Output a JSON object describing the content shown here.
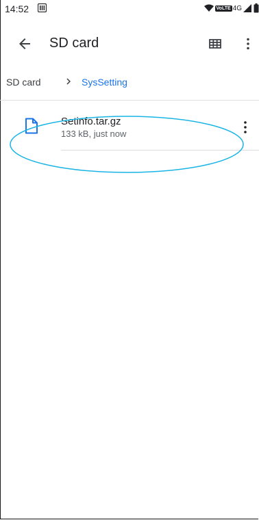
{
  "status": {
    "time": "14:52",
    "network": "4G",
    "volte": "VoLTE"
  },
  "app_bar": {
    "title": "SD card",
    "icons": [
      "back-arrow-icon",
      "grid-view-icon",
      "more-vert-icon"
    ]
  },
  "breadcrumb": {
    "root": "SD card",
    "current": "SysSetting",
    "current_color": "#1a73e8"
  },
  "files": [
    {
      "name": "Setinfo.tar.gz",
      "meta": "133 kB, just now",
      "icon": "document-icon"
    }
  ],
  "colors": {
    "accent": "#1a73e8",
    "highlight": "#19b4e6"
  }
}
